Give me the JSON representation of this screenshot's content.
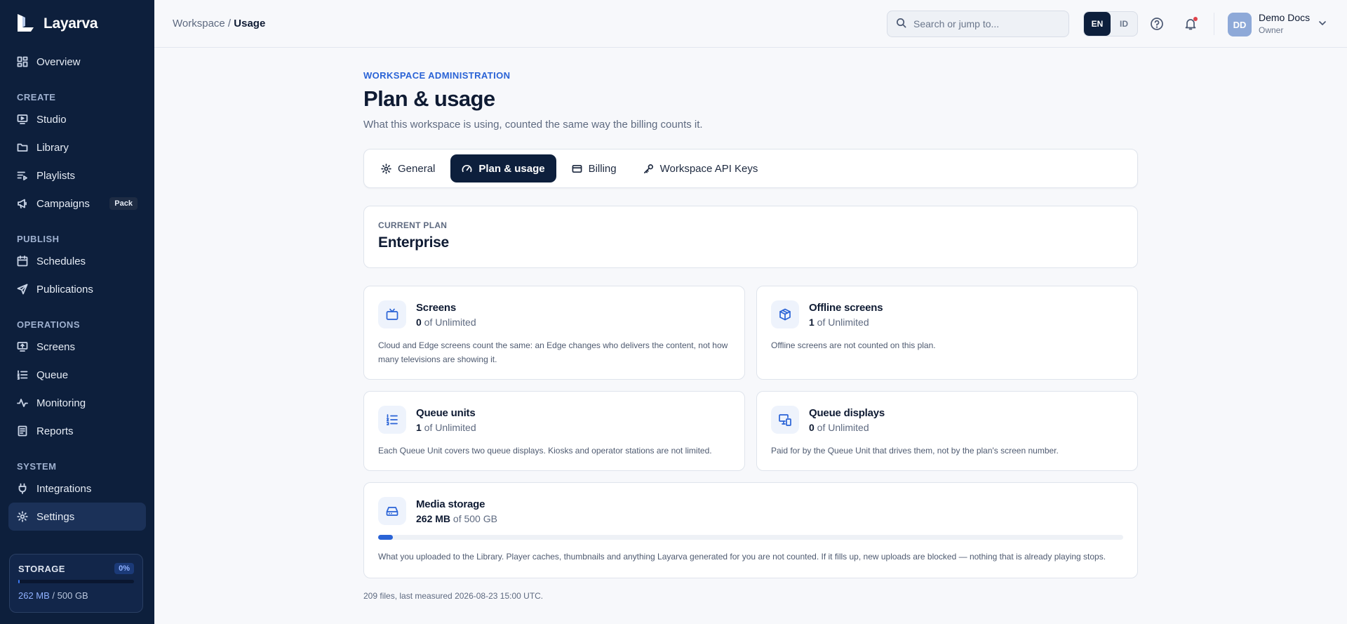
{
  "brand": {
    "name": "Layarva"
  },
  "sidebar": {
    "top": [
      {
        "label": "Overview"
      }
    ],
    "sections": [
      {
        "title": "CREATE",
        "items": [
          {
            "label": "Studio"
          },
          {
            "label": "Library"
          },
          {
            "label": "Playlists"
          },
          {
            "label": "Campaigns",
            "badge": "Pack"
          }
        ]
      },
      {
        "title": "PUBLISH",
        "items": [
          {
            "label": "Schedules"
          },
          {
            "label": "Publications"
          }
        ]
      },
      {
        "title": "OPERATIONS",
        "items": [
          {
            "label": "Screens"
          },
          {
            "label": "Queue"
          },
          {
            "label": "Monitoring"
          },
          {
            "label": "Reports"
          }
        ]
      },
      {
        "title": "SYSTEM",
        "items": [
          {
            "label": "Integrations"
          },
          {
            "label": "Settings"
          }
        ]
      }
    ],
    "storage": {
      "title": "STORAGE",
      "percent_label": "0%",
      "fraction": 0.0005,
      "used": "262 MB",
      "total": " / 500 GB"
    }
  },
  "topbar": {
    "breadcrumb": {
      "parent": "Workspace",
      "sep": " / ",
      "current": "Usage"
    },
    "search": {
      "placeholder": "Search or jump to..."
    },
    "lang": {
      "en": "EN",
      "id": "ID"
    },
    "user": {
      "initials": "DD",
      "name": "Demo Docs",
      "role": "Owner"
    }
  },
  "page": {
    "eyebrow": "WORKSPACE ADMINISTRATION",
    "title": "Plan & usage",
    "subtitle": "What this workspace is using, counted the same way the billing counts it.",
    "tabs": [
      {
        "label": "General"
      },
      {
        "label": "Plan & usage"
      },
      {
        "label": "Billing"
      },
      {
        "label": "Workspace API Keys"
      }
    ],
    "plan": {
      "label": "CURRENT PLAN",
      "value": "Enterprise"
    },
    "cards": [
      {
        "name": "Screens",
        "count": "0",
        "of": " of Unlimited",
        "desc": "Cloud and Edge screens count the same: an Edge changes who delivers the content, not how many televisions are showing it."
      },
      {
        "name": "Offline screens",
        "count": "1",
        "of": " of Unlimited",
        "desc": "Offline screens are not counted on this plan."
      },
      {
        "name": "Queue units",
        "count": "1",
        "of": " of Unlimited",
        "desc": "Each Queue Unit covers two queue displays. Kiosks and operator stations are not limited."
      },
      {
        "name": "Queue displays",
        "count": "0",
        "of": " of Unlimited",
        "desc": "Paid for by the Queue Unit that drives them, not by the plan's screen number."
      }
    ],
    "storage": {
      "name": "Media storage",
      "used": "262 MB",
      "of": " of 500 GB",
      "fraction": 0.02,
      "desc": "What you uploaded to the Library. Player caches, thumbnails and anything Layarva generated for you are not counted. If it fills up, new uploads are blocked — nothing that is already playing stops."
    },
    "footer": "209 files, last measured 2026-08-23 15:00 UTC."
  }
}
